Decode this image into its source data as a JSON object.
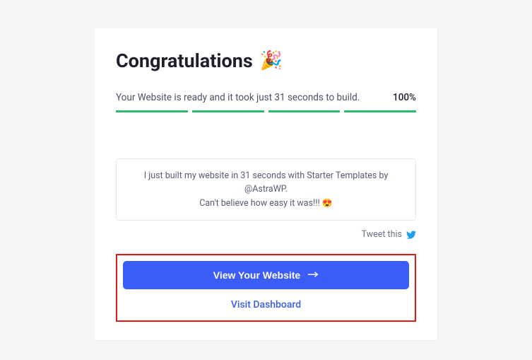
{
  "heading": {
    "title": "Congratulations",
    "emoji": "🎉"
  },
  "status": {
    "message": "Your Website is ready and it took just 31 seconds to build.",
    "percent": "100%"
  },
  "tweet": {
    "line1": "I just built my website in 31 seconds with Starter Templates by @AstraWP.",
    "line2": "Can't believe how easy it was!!!",
    "emoji": "😍",
    "link_label": "Tweet this"
  },
  "actions": {
    "primary": "View Your Website",
    "secondary": "Visit Dashboard"
  }
}
